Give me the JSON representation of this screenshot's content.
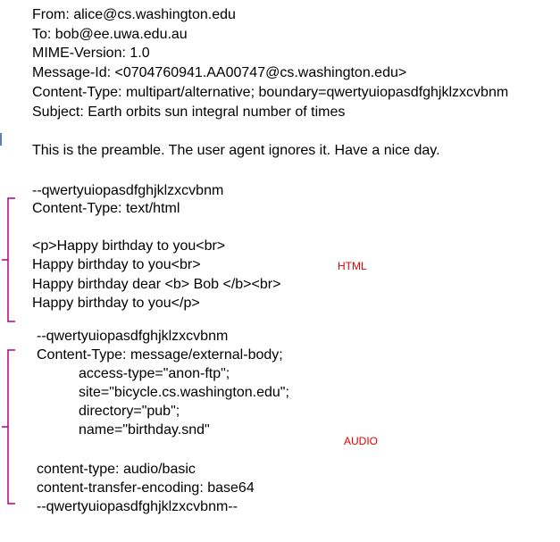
{
  "header": {
    "from": "From: alice@cs.washington.edu",
    "to": "To: bob@ee.uwa.edu.au",
    "mime": "MIME-Version: 1.0",
    "message_id": "Message-Id: <0704760941.AA00747@cs.washington.edu>",
    "content_type": "Content-Type: multipart/alternative; boundary=qwertyuiopasdfghjklzxcvbnm",
    "subject": "Subject: Earth orbits sun integral number of times"
  },
  "preamble": "This is the preamble. The user agent ignores it. Have a nice day.",
  "html_part": {
    "boundary": "--qwertyuiopasdfghjklzxcvbnm",
    "content_type": "Content-Type: text/html",
    "lines": [
      "<p>Happy birthday to you<br>",
      "Happy birthday to you<br>",
      "Happy birthday dear <b> Bob </b><br>",
      "Happy birthday to you</p>"
    ],
    "label": "HTML"
  },
  "audio_part": {
    "boundary": "--qwertyuiopasdfghjklzxcvbnm",
    "content_type": "Content-Type: message/external-body;",
    "params": [
      "access-type=\"anon-ftp\";",
      "site=\"bicycle.cs.washington.edu\";",
      "directory=\"pub\";",
      "name=\"birthday.snd\""
    ],
    "label": "AUDIO",
    "inner_content_type": "content-type: audio/basic",
    "encoding": "content-transfer-encoding: base64",
    "end_boundary": "--qwertyuiopasdfghjklzxcvbnm--"
  },
  "colors": {
    "label": "#e00000",
    "brace": "#b0008a",
    "tick": "#5b7fb2"
  }
}
